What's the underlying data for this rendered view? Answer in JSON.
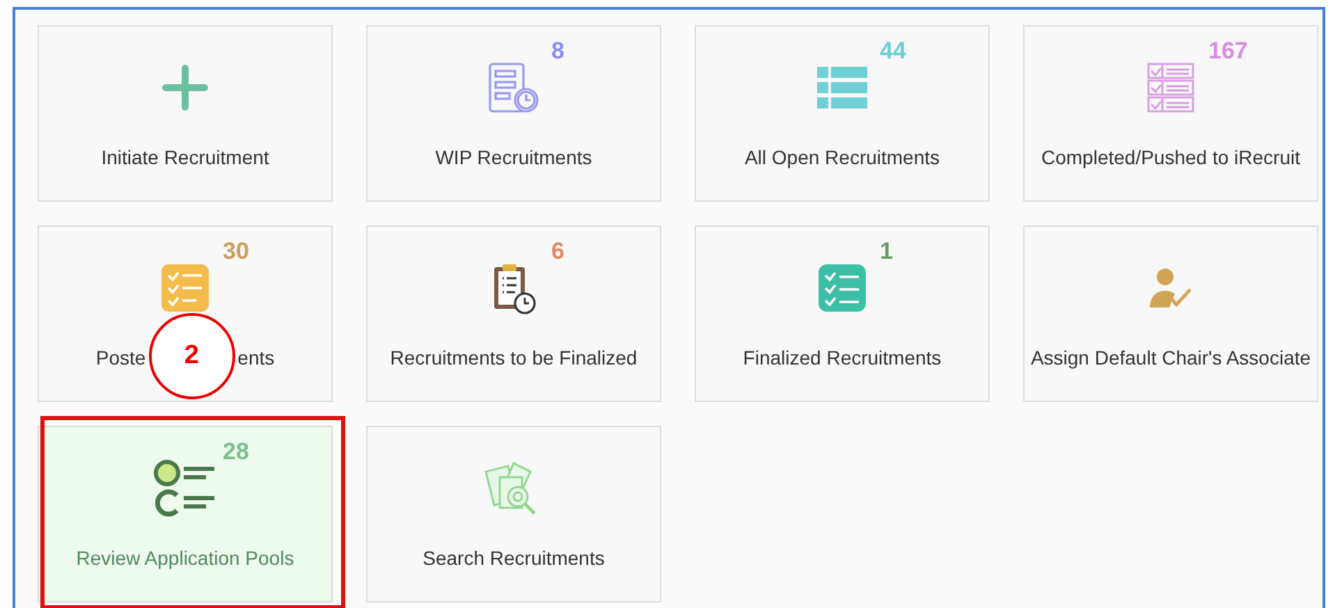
{
  "tiles": [
    {
      "kind": "plus",
      "label_parts": [
        "Initiate Recruitment"
      ],
      "selected": false
    },
    {
      "kind": "document-clock",
      "count": "8",
      "color": "#8c8cf0",
      "label_parts": [
        "WIP Recruitments"
      ],
      "selected": false
    },
    {
      "kind": "list",
      "count": "44",
      "color": "#6bcfd6",
      "label_parts": [
        "All Open Recruitments"
      ],
      "selected": false
    },
    {
      "kind": "checklist-table",
      "count": "167",
      "color": "#d68fe0",
      "label_parts": [
        "Completed/Pushed to iRecruit"
      ],
      "selected": false
    },
    {
      "kind": "checklist-card",
      "count": "30",
      "color": "#c9a060",
      "label_parts": [
        "Poste",
        "ents"
      ],
      "callout": "2",
      "selected": false
    },
    {
      "kind": "clipboard-clock",
      "count": "6",
      "color": "#e08a6a",
      "label_parts": [
        "Recruitments to be Finalized"
      ],
      "selected": false
    },
    {
      "kind": "checklist-square",
      "count": "1",
      "color": "#6a9a6a",
      "label_parts": [
        "Finalized Recruitments"
      ],
      "selected": false
    },
    {
      "kind": "person-check",
      "label_parts": [
        "Assign Default Chair's Associate"
      ],
      "selected": false
    },
    {
      "kind": "options-list",
      "count": "28",
      "color": "#7cc08a",
      "label_parts": [
        "Review Application Pools"
      ],
      "selected": true,
      "outlined": true
    },
    {
      "kind": "documents-search",
      "label_parts": [
        "Search Recruitments"
      ],
      "selected": false
    }
  ]
}
